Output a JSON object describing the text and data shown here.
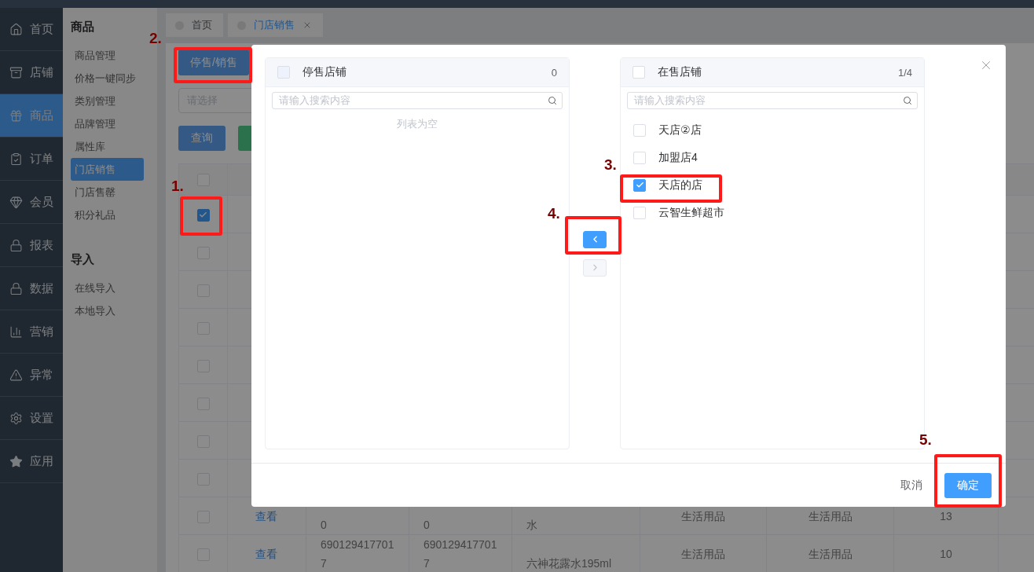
{
  "nav": [
    {
      "label": "首页",
      "selected": false
    },
    {
      "label": "店铺",
      "selected": false
    },
    {
      "label": "商品",
      "selected": true
    },
    {
      "label": "订单",
      "selected": false
    },
    {
      "label": "会员",
      "selected": false
    },
    {
      "label": "报表",
      "selected": false
    },
    {
      "label": "数据",
      "selected": false
    },
    {
      "label": "营销",
      "selected": false
    },
    {
      "label": "异常",
      "selected": false
    },
    {
      "label": "设置",
      "selected": false
    },
    {
      "label": "应用",
      "selected": false
    }
  ],
  "sub_sidebar": {
    "sections": [
      {
        "title": "商品",
        "items": [
          {
            "label": "商品管理",
            "selected": false
          },
          {
            "label": "价格一键同步",
            "selected": false
          },
          {
            "label": "类别管理",
            "selected": false
          },
          {
            "label": "品牌管理",
            "selected": false
          },
          {
            "label": "属性库",
            "selected": false
          },
          {
            "label": "门店销售",
            "selected": true
          },
          {
            "label": "门店售罄",
            "selected": false
          },
          {
            "label": "积分礼品",
            "selected": false
          }
        ]
      },
      {
        "title": "导入",
        "items": [
          {
            "label": "在线导入",
            "selected": false
          },
          {
            "label": "本地导入",
            "selected": false
          }
        ]
      }
    ]
  },
  "tabs": [
    {
      "label": "首页",
      "selected": false,
      "closable": false
    },
    {
      "label": "门店销售",
      "selected": true,
      "closable": true
    }
  ],
  "toolbar": {
    "toggle_button": "停售/销售",
    "select_placeholder": "请选择",
    "query_button": "查询"
  },
  "table": {
    "header_checked": false,
    "rows": [
      {
        "selected": true
      },
      {
        "selected": false
      },
      {
        "selected": false
      },
      {
        "selected": false
      },
      {
        "selected": false
      },
      {
        "selected": false
      },
      {
        "selected": false
      },
      {
        "selected": false
      },
      {
        "selected": false,
        "link": "查看",
        "cells": [
          "0",
          "0",
          "水",
          "生活用品",
          "生活用品",
          "13"
        ]
      },
      {
        "selected": false,
        "link": "查看",
        "cells": [
          "6901294177017",
          "6901294177017",
          "六神花露水195ml",
          "生活用品",
          "生活用品",
          "10"
        ]
      }
    ]
  },
  "dialog": {
    "source": {
      "title": "停售店铺",
      "count": "0",
      "checked": false,
      "disabled": true,
      "placeholder": "请输入搜索内容",
      "empty_text": "列表为空"
    },
    "target": {
      "title": "在售店铺",
      "count": "1/4",
      "checked": false,
      "disabled": false,
      "placeholder": "请输入搜索内容",
      "items": [
        {
          "label": "天店②店",
          "checked": false
        },
        {
          "label": "加盟店4",
          "checked": false
        },
        {
          "label": "天店的店",
          "checked": true
        },
        {
          "label": "云智生鲜超市",
          "checked": false
        }
      ]
    },
    "transfer_buttons": [
      {
        "kind": "left",
        "disabled": false
      },
      {
        "kind": "right",
        "disabled": true
      }
    ],
    "cancel": "取消",
    "confirm": "确定"
  },
  "annotations": [
    {
      "label": "1."
    },
    {
      "label": "2."
    },
    {
      "label": "3."
    },
    {
      "label": "4."
    },
    {
      "label": "5."
    }
  ]
}
